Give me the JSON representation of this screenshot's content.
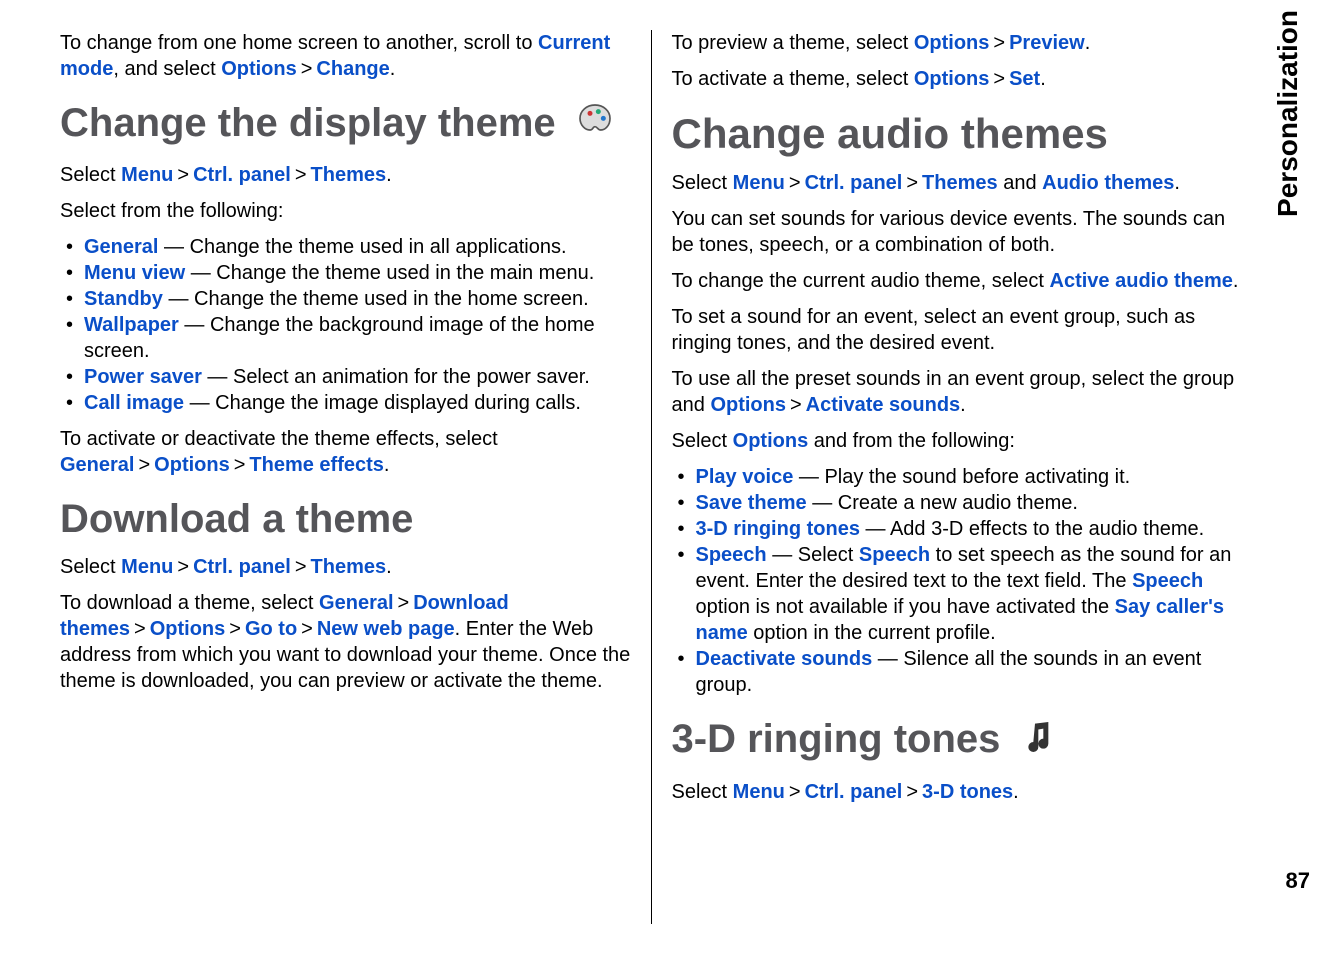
{
  "sideLabel": "Personalization",
  "pageNumber": "87",
  "left": {
    "intro": {
      "t1": "To change from one home screen to another, scroll to ",
      "currentMode": "Current mode",
      "t2": ", and select ",
      "options": "Options",
      "gt": ">",
      "change": "Change",
      "period": "."
    },
    "h1_display": "Change the display theme",
    "displayPath": {
      "select": "Select ",
      "menu": "Menu",
      "gt": ">",
      "ctrl": "Ctrl. panel",
      "themes": "Themes",
      "period": "."
    },
    "selectFollowing": "Select from the following:",
    "items": [
      {
        "label": "General",
        "desc": " — Change the theme used in all applications."
      },
      {
        "label": "Menu view",
        "desc": " — Change the theme used in the main menu."
      },
      {
        "label": "Standby",
        "desc": " — Change the theme used in the home screen."
      },
      {
        "label": "Wallpaper",
        "desc": " — Change the background image of the home screen."
      },
      {
        "label": "Power saver",
        "desc": " — Select an animation for the power saver."
      },
      {
        "label": "Call image",
        "desc": " — Change the image displayed during calls."
      }
    ],
    "themeEffects": {
      "t1": "To activate or deactivate the theme effects, select ",
      "general": "General",
      "gt": ">",
      "options": "Options",
      "effects": "Theme effects",
      "period": "."
    },
    "h1_download": "Download a theme",
    "downloadPath": {
      "select": "Select ",
      "menu": "Menu",
      "gt": ">",
      "ctrl": "Ctrl. panel",
      "themes": "Themes",
      "period": "."
    },
    "downloadText": {
      "t1": "To download a theme, select ",
      "general": "General",
      "gt": ">",
      "dlthemes": "Download themes",
      "options": "Options",
      "goto": "Go to",
      "nwp": "New web page",
      "t2": ". Enter the Web address from which you want to download your theme. Once the theme is downloaded, you can preview or activate the theme."
    }
  },
  "right": {
    "preview": {
      "t1": "To preview a theme, select ",
      "options": "Options",
      "gt": ">",
      "preview": "Preview",
      "period": "."
    },
    "activate": {
      "t1": "To activate a theme, select ",
      "options": "Options",
      "gt": ">",
      "set": "Set",
      "period": "."
    },
    "h1_audio": "Change audio themes",
    "audioPath": {
      "select": "Select ",
      "menu": "Menu",
      "gt": ">",
      "ctrl": "Ctrl. panel",
      "themes": "Themes",
      "and": " and ",
      "audio": "Audio themes",
      "period": "."
    },
    "audioDesc": "You can set sounds for various device events. The sounds can be tones, speech, or a combination of both.",
    "changeAudio": {
      "t1": "To change the current audio theme, select ",
      "active": "Active audio theme",
      "period": "."
    },
    "setSound": "To set a sound for an event, select an event group, such as ringing tones, and the desired event.",
    "preset": {
      "t1": "To use all the preset sounds in an event group, select the group and ",
      "options": "Options",
      "gt": ">",
      "activateSounds": "Activate sounds",
      "period": "."
    },
    "selectOptions": {
      "t1": "Select ",
      "options": "Options",
      "t2": " and from the following:"
    },
    "items": [
      {
        "label": "Play voice",
        "desc": " — Play the sound before activating it."
      },
      {
        "label": "Save theme",
        "desc": " — Create a new audio theme."
      },
      {
        "label": "3-D ringing tones",
        "desc": " — Add 3-D effects to the audio theme."
      }
    ],
    "speechItem": {
      "label": "Speech",
      "t1": " — Select ",
      "speech2": "Speech",
      "t2": " to set speech as the sound for an event. Enter the desired text to the text field. The ",
      "speech3": "Speech",
      "t3": " option is not available if you have activated the ",
      "say": "Say caller's name",
      "t4": " option in the current profile."
    },
    "deactivate": {
      "label": "Deactivate sounds",
      "desc": " — Silence all the sounds in an event group."
    },
    "h1_3d": "3-D ringing tones",
    "path3d": {
      "select": "Select ",
      "menu": "Menu",
      "gt": ">",
      "ctrl": "Ctrl. panel",
      "tones": "3-D tones",
      "period": "."
    }
  }
}
